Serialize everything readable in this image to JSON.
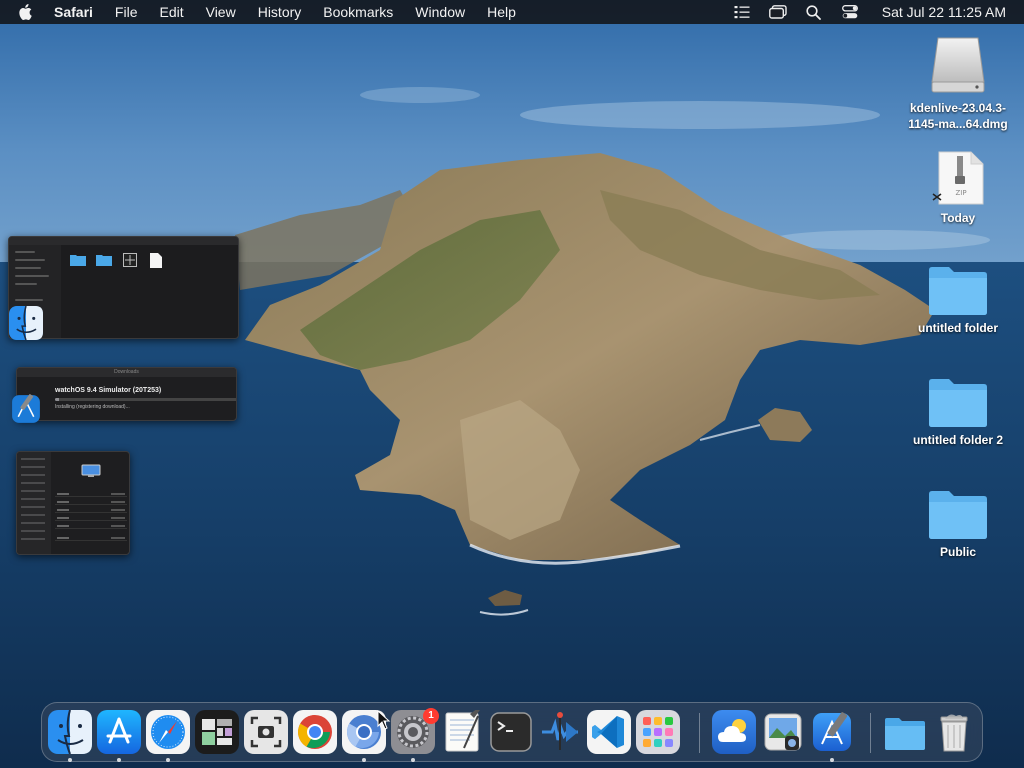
{
  "menubar": {
    "app_name": "Safari",
    "items": [
      "File",
      "Edit",
      "View",
      "History",
      "Bookmarks",
      "Window",
      "Help"
    ],
    "clock": "Sat Jul 22  11:25 AM",
    "status_icons": [
      "list-icon",
      "screen-mirroring-icon",
      "search-icon",
      "control-center-icon"
    ]
  },
  "desktop": {
    "items": [
      {
        "label": "kdenlive-23.04.3-\n1145-ma...64.dmg",
        "icon": "disk-image-icon"
      },
      {
        "label": "Today",
        "icon": "zip-archive-icon"
      },
      {
        "label": "untitled folder",
        "icon": "folder-icon"
      },
      {
        "label": "untitled folder 2",
        "icon": "folder-icon"
      },
      {
        "label": "Public",
        "icon": "folder-icon"
      }
    ]
  },
  "windows": {
    "downloads": {
      "title": "Downloads",
      "item": "watchOS 9.4 Simulator (20T253)",
      "status": "Installing (registering download)...",
      "progress": 0.02
    }
  },
  "dock": {
    "apps": [
      {
        "name": "Finder",
        "running": true
      },
      {
        "name": "App Store",
        "running": true
      },
      {
        "name": "Safari",
        "running": true
      },
      {
        "name": "Mosaic",
        "running": false
      },
      {
        "name": "Screenshot",
        "running": false
      },
      {
        "name": "Chrome",
        "running": false
      },
      {
        "name": "Chromium",
        "running": true
      },
      {
        "name": "System Settings",
        "running": true,
        "badge": "1"
      },
      {
        "name": "TextEdit",
        "running": false
      },
      {
        "name": "Terminal",
        "running": false
      },
      {
        "name": "Instruments",
        "running": false
      },
      {
        "name": "Visual Studio Code",
        "running": false
      },
      {
        "name": "Launchpad",
        "running": false
      },
      {
        "name": "Weather",
        "running": false
      },
      {
        "name": "Preview",
        "running": false
      },
      {
        "name": "Xcode",
        "running": true
      },
      {
        "name": "Downloads",
        "running": false
      },
      {
        "name": "Trash",
        "running": false
      }
    ]
  }
}
